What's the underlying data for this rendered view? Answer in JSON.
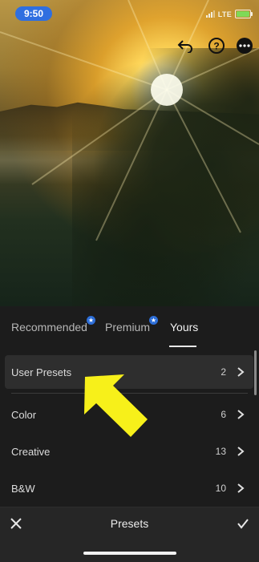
{
  "status_bar": {
    "time": "9:50",
    "network": "LTE"
  },
  "photo_toolbar": {
    "icons": [
      "undo-icon",
      "help-icon",
      "more-icon"
    ]
  },
  "tabs": [
    {
      "label": "Recommended",
      "badge": "★"
    },
    {
      "label": "Premium",
      "badge": "★"
    },
    {
      "label": "Yours",
      "active": true
    }
  ],
  "preset_groups": [
    {
      "label": "User Presets",
      "count": "2",
      "selected": true
    },
    {
      "label": "Color",
      "count": "6"
    },
    {
      "label": "Creative",
      "count": "13"
    },
    {
      "label": "B&W",
      "count": "10"
    }
  ],
  "bottom_bar": {
    "title": "Presets",
    "left_icon": "close-icon",
    "right_icon": "checkmark-icon"
  },
  "colors": {
    "accent": "#2d6ed8",
    "arrow": "#f7f01a",
    "panel": "#1c1c1c",
    "selected_row": "#2e2e2e"
  }
}
